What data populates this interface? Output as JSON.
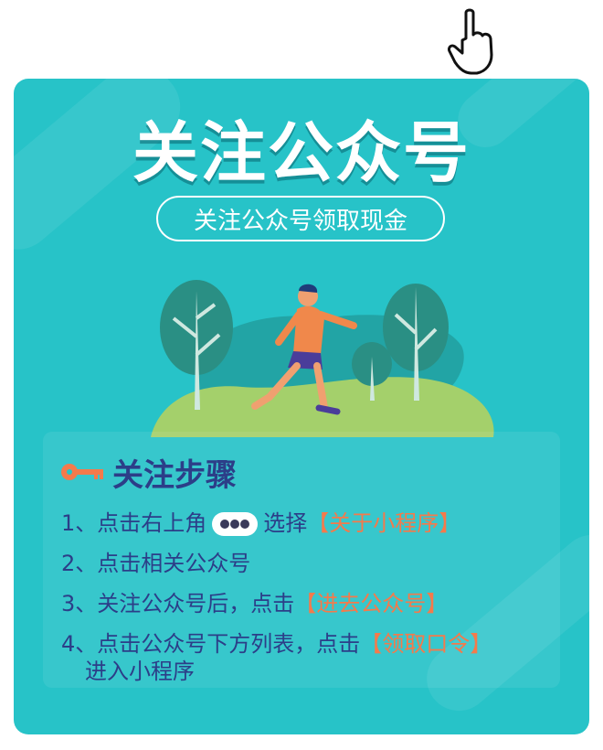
{
  "hero": {
    "title": "关注公众号",
    "subtitle": "关注公众号领取现金"
  },
  "steps": {
    "heading": "关注步骤",
    "items": [
      {
        "prefix": "1、点击右上角",
        "middle": "选择",
        "highlight": "【关于小程序】"
      },
      {
        "prefix": "2、点击相关公众号"
      },
      {
        "prefix": "3、关注公众号后，点击",
        "highlight": "【进去公众号】"
      },
      {
        "prefix": "4、点击公众号下方列表，点击",
        "highlight": "【领取口令】",
        "line2": "进入小程序"
      }
    ]
  },
  "colors": {
    "background": "#27c3c8",
    "text": "#2c3e88",
    "highlight": "#f47a4b"
  },
  "icons": {
    "pointer": "hand-pointer-icon",
    "key": "key-icon",
    "more": "more-dots-icon"
  }
}
